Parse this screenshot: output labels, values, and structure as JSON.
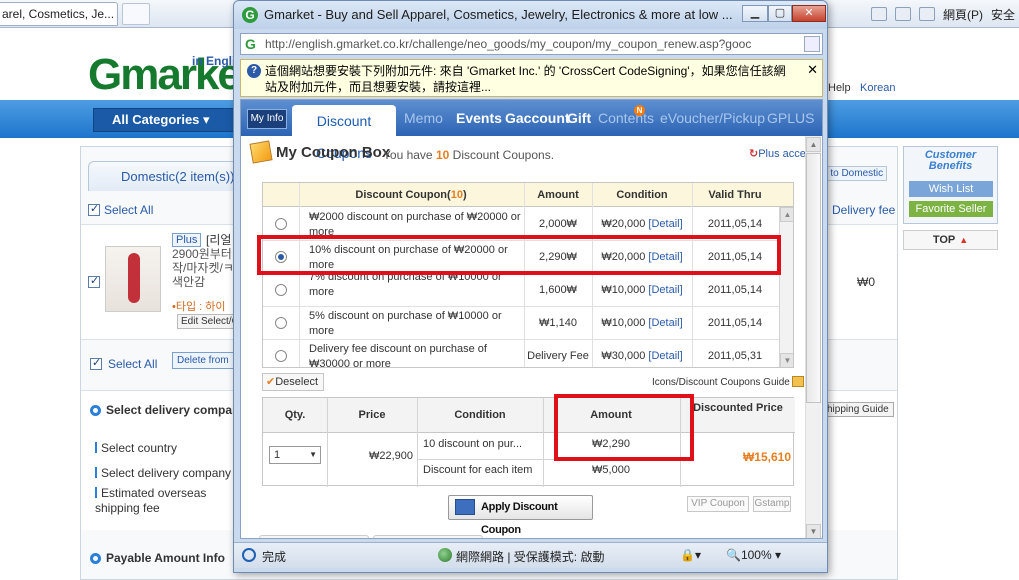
{
  "background": {
    "tab_title": "arel, Cosmetics, Je...",
    "toolbar_right": {
      "page_menu": "網頁(P)",
      "safety_menu": "安全"
    },
    "logo_text": "Gmarket",
    "logo_sub": "in Engli",
    "help": "Help",
    "language": "Korean",
    "all_categories": "All Categories",
    "domestic_tab": "Domestic(2 item(s))",
    "to_domestic": "e to Domestic",
    "select_all_top": "Select All",
    "delivery_fee_header": "Delivery fee",
    "item": {
      "plus_badge": "Plus",
      "title": "[리얼",
      "lines": "2900원부터\n작/마자켓/ㅋ\n색안감",
      "type": "•타입 : 하이",
      "edit_select": "Edit Select/C",
      "price": "₩0"
    },
    "select_all_bottom": "Select All",
    "delete_button": "Delete from",
    "delivery_section_title": "Select delivery compar",
    "shipping_guide": "hipping Guide",
    "fields": [
      "Select country",
      "Select delivery company",
      "Estimated overseas",
      "shipping fee"
    ],
    "payment_section_title": "Payable Amount Info",
    "benefits_title": "Customer Benefits",
    "wish_list": "Wish List",
    "favorite_seller": "Favorite Seller",
    "top_button": "TOP"
  },
  "popup": {
    "window_title": "Gmarket - Buy and Sell Apparel, Cosmetics, Jewelry, Electronics & more at low ...",
    "window_controls": {
      "minimize": "▁",
      "maximize": "▢",
      "close": "✕"
    },
    "address": "http://english.gmarket.co.kr/challenge/neo_goods/my_coupon/my_coupon_renew.asp?gooc",
    "infobar": "這個網站想要安裝下列附加元件: 來自 'Gmarket Inc.' 的 'CrossCert CodeSigning'，如果您信任該網站及附加元件，而且想要安裝，請按這裡...",
    "nav_tabs": {
      "my_info": "My Info",
      "discount_coupons": "Discount Coupons",
      "memo": "Memo",
      "events": "Events",
      "gaccount": "Gaccount",
      "gift": "Gift",
      "contents": "Contents",
      "contents_badge": "N",
      "evoucher": "eVoucher/Pickup",
      "gplus": "GPLUS"
    },
    "coupon_box_title": "My Coupon Box",
    "coupon_count_prefix": "You have ",
    "coupon_count": "10",
    "coupon_count_suffix": " Discount Coupons.",
    "plus_access": "Plus access",
    "table_headers": {
      "discount_coupon": "Discount Coupon(",
      "discount_coupon_count": "10",
      "discount_coupon_close": ")",
      "amount": "Amount",
      "condition": "Condition",
      "valid_thru": "Valid Thru"
    },
    "coupons": [
      {
        "desc": "₩2000 discount on purchase of ₩20000 or more",
        "amount": "2,000₩",
        "condition": "₩20,000",
        "detail": "[Detail]",
        "valid": "2011,05,14",
        "selected": false
      },
      {
        "desc": "10% discount on purchase of ₩20000 or more",
        "amount": "2,290₩",
        "condition": "₩20,000",
        "detail": "[Detail]",
        "valid": "2011,05,14",
        "selected": true
      },
      {
        "desc": "7% discount on purchase of ₩10000 or more",
        "amount": "1,600₩",
        "condition": "₩10,000",
        "detail": "[Detail]",
        "valid": "2011,05,14",
        "selected": false
      },
      {
        "desc": "5% discount on purchase of ₩10000 or more",
        "amount": "₩1,140",
        "condition": "₩10,000",
        "detail": "[Detail]",
        "valid": "2011,05,14",
        "selected": false
      },
      {
        "desc": "Delivery fee discount on purchase of ₩30000 or more",
        "amount": "Delivery Fee",
        "condition": "₩30,000",
        "detail": "[Detail]",
        "valid": "2011,05,31",
        "selected": false
      }
    ],
    "deselect": "Deselect",
    "guide_link": "Icons/Discount Coupons Guide",
    "summary_headers": {
      "qty": "Qty.",
      "price": "Price",
      "condition": "Condition",
      "amount": "Amount",
      "discounted_price": "Discounted Price"
    },
    "summary": {
      "qty": "1",
      "price": "₩22,900",
      "condition_1": "10 discount on pur...",
      "condition_2": "Discount for each item",
      "amount_1": "₩2,290",
      "amount_2": "₩5,000",
      "discounted_price": "₩15,610"
    },
    "apply_button": "Apply Discount Coupon",
    "vip_coupon": "VIP Coupon",
    "gstamp": "Gstamp",
    "status": {
      "done": "完成",
      "zone": "網際網路 | 受保護模式: 啟動",
      "zoom": "100%"
    }
  },
  "colors": {
    "accent_orange": "#e67e22",
    "nav_blue": "#2c64b4",
    "highlight_red": "#e0101a",
    "link_blue": "#2a5aa8"
  }
}
